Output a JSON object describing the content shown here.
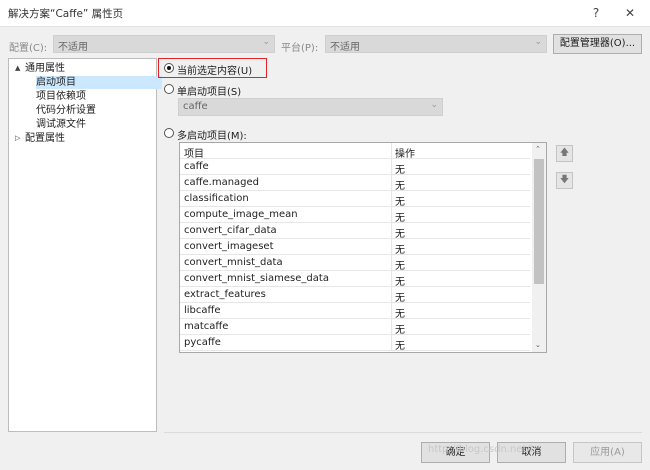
{
  "window": {
    "title": "解决方案“Caffe” 属性页",
    "help_label": "?",
    "close_label": "✕"
  },
  "config": {
    "config_label": "配置(C):",
    "config_value": "不适用",
    "platform_label": "平台(P):",
    "platform_value": "不适用",
    "manager_button": "配置管理器(O)..."
  },
  "tree": {
    "common_group": "通用属性",
    "items": [
      "启动项目",
      "项目依赖项",
      "代码分析设置",
      "调试源文件"
    ],
    "config_group": "配置属性"
  },
  "startup": {
    "current_selection_label": "当前选定内容(U)",
    "single_label": "单启动项目(S)",
    "single_value": "caffe",
    "multi_label": "多启动项目(M):"
  },
  "table": {
    "headers": [
      "项目",
      "操作"
    ],
    "rows": [
      [
        "caffe",
        "无"
      ],
      [
        "caffe.managed",
        "无"
      ],
      [
        "classification",
        "无"
      ],
      [
        "compute_image_mean",
        "无"
      ],
      [
        "convert_cifar_data",
        "无"
      ],
      [
        "convert_imageset",
        "无"
      ],
      [
        "convert_mnist_data",
        "无"
      ],
      [
        "convert_mnist_siamese_data",
        "无"
      ],
      [
        "extract_features",
        "无"
      ],
      [
        "libcaffe",
        "无"
      ],
      [
        "matcaffe",
        "无"
      ],
      [
        "pycaffe",
        "无"
      ]
    ]
  },
  "buttons": {
    "ok": "确定",
    "cancel": "取消",
    "apply": "应用(A)"
  },
  "watermark": "http://blog.csdn.net/l...",
  "icons": {
    "up": "arrow-up-icon",
    "down": "arrow-down-icon"
  }
}
